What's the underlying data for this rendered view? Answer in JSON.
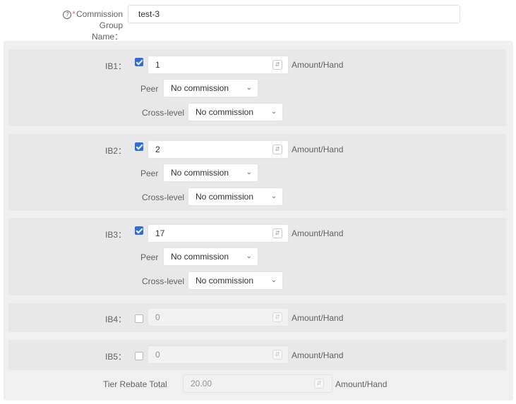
{
  "form": {
    "name_label": "Commission Group Name:",
    "name_label_line1": "Commission Group",
    "name_label_line2": "Name：",
    "required_mark": "*",
    "help_icon": "question-circle-icon",
    "name_value": "test-3"
  },
  "ib_rows": [
    {
      "label": "IB1：",
      "checked": true,
      "value": "1",
      "unit": "Amount/Hand",
      "peer_label": "Peer",
      "peer_value": "No commission",
      "cross_label": "Cross-level",
      "cross_value": "No commission"
    },
    {
      "label": "IB2：",
      "checked": true,
      "value": "2",
      "unit": "Amount/Hand",
      "peer_label": "Peer",
      "peer_value": "No commission",
      "cross_label": "Cross-level",
      "cross_value": "No commission"
    },
    {
      "label": "IB3：",
      "checked": true,
      "value": "17",
      "unit": "Amount/Hand",
      "peer_label": "Peer",
      "peer_value": "No commission",
      "cross_label": "Cross-level",
      "cross_value": "No commission"
    },
    {
      "label": "IB4：",
      "checked": false,
      "value": "0",
      "unit": "Amount/Hand"
    },
    {
      "label": "IB5：",
      "checked": false,
      "value": "0",
      "unit": "Amount/Hand"
    }
  ],
  "total": {
    "label": "Tier Rebate Total",
    "value": "20.00",
    "unit": "Amount/Hand"
  },
  "colors": {
    "checkbox_checked": "#2c6ed5",
    "required": "#f56c6c",
    "panel_bg": "#e8e8e8"
  }
}
